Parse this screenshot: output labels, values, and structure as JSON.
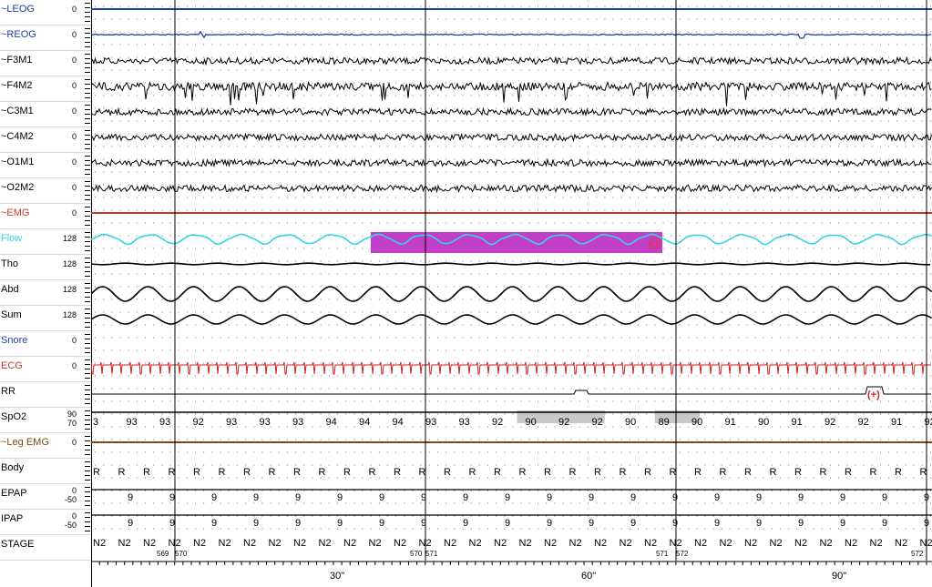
{
  "channels": [
    {
      "id": "leog",
      "label": "~LEOG",
      "gain": "0",
      "label_color": "#1f3fa0",
      "trace_color": "#1f3fa0",
      "kind": "flat-blue"
    },
    {
      "id": "reog",
      "label": "~REOG",
      "gain": "0",
      "label_color": "#1f3fa0",
      "trace_color": "#1f3fa0",
      "kind": "flat-blue-blips"
    },
    {
      "id": "f3m1",
      "label": "~F3M1",
      "gain": "0",
      "label_color": "#000000",
      "trace_color": "#000000",
      "kind": "eeg"
    },
    {
      "id": "f4m2",
      "label": "~F4M2",
      "gain": "0",
      "label_color": "#000000",
      "trace_color": "#000000",
      "kind": "eeg-spiky"
    },
    {
      "id": "c3m1",
      "label": "~C3M1",
      "gain": "0",
      "label_color": "#000000",
      "trace_color": "#000000",
      "kind": "eeg"
    },
    {
      "id": "c4m2",
      "label": "~C4M2",
      "gain": "0",
      "label_color": "#000000",
      "trace_color": "#000000",
      "kind": "eeg"
    },
    {
      "id": "o1m1",
      "label": "~O1M1",
      "gain": "0",
      "label_color": "#000000",
      "trace_color": "#000000",
      "kind": "eeg"
    },
    {
      "id": "o2m2",
      "label": "~O2M2",
      "gain": "0",
      "label_color": "#000000",
      "trace_color": "#000000",
      "kind": "eeg"
    },
    {
      "id": "emg",
      "label": "~EMG",
      "gain": "0",
      "label_color": "#c0392b",
      "trace_color": "#c0392b",
      "kind": "flat-red"
    },
    {
      "id": "flow",
      "label": "Flow",
      "gain": "128",
      "label_color": "#33d4e6",
      "trace_color": "#33d4e6",
      "kind": "flow"
    },
    {
      "id": "tho",
      "label": "Tho",
      "gain": "128",
      "label_color": "#000000",
      "trace_color": "#000000",
      "kind": "tho"
    },
    {
      "id": "abd",
      "label": "Abd",
      "gain": "128",
      "label_color": "#000000",
      "trace_color": "#000000",
      "kind": "resp"
    },
    {
      "id": "sum",
      "label": "Sum",
      "gain": "128",
      "label_color": "#000000",
      "trace_color": "#000000",
      "kind": "resp-small"
    },
    {
      "id": "snore",
      "label": "Snore",
      "gain": "0",
      "label_color": "#1f3fa0",
      "trace_color": "#1f3fa0",
      "kind": "empty"
    },
    {
      "id": "ecg",
      "label": "ECG",
      "gain": "0",
      "label_color": "#c0392b",
      "trace_color": "#d42020",
      "kind": "ecg"
    },
    {
      "id": "rr",
      "label": "RR",
      "gain": "",
      "label_color": "#000000",
      "trace_color": "#000000",
      "kind": "rr"
    },
    {
      "id": "spo2",
      "label": "SpO2",
      "gain": "90\n70",
      "label_color": "#000000",
      "trace_color": "#000000",
      "kind": "spo2"
    },
    {
      "id": "legemg",
      "label": "~Leg EMG",
      "gain": "0",
      "label_color": "#7a4a10",
      "trace_color": "#7a4a10",
      "kind": "flat-brown"
    },
    {
      "id": "body",
      "label": "Body",
      "gain": "",
      "label_color": "#000000",
      "trace_color": "#000000",
      "kind": "body"
    },
    {
      "id": "epap",
      "label": "EPAP",
      "gain": "0\n-50",
      "label_color": "#000000",
      "trace_color": "#000000",
      "kind": "pap"
    },
    {
      "id": "ipap",
      "label": "IPAP",
      "gain": "0\n-50",
      "label_color": "#000000",
      "trace_color": "#000000",
      "kind": "pap"
    },
    {
      "id": "stage",
      "label": "STAGE",
      "gain": "",
      "label_color": "#000000",
      "trace_color": "#000000",
      "kind": "stage"
    }
  ],
  "spo2_values": [
    "3",
    "93",
    "93",
    "92",
    "93",
    "93",
    "93",
    "94",
    "94",
    "94",
    "93",
    "93",
    "92",
    "90",
    "92",
    "92",
    "90",
    "89",
    "90",
    "91",
    "90",
    "91",
    "92",
    "92",
    "91",
    "92"
  ],
  "spo2_highlights": [
    {
      "from_sec": 17,
      "to_sec": 20.5,
      "color": "#c8c8c8"
    },
    {
      "from_sec": 22.5,
      "to_sec": 24.3,
      "color": "#c8c8c8"
    }
  ],
  "body_value": "R",
  "pap_value": "9",
  "stage_value": "N2",
  "epoch_numbers": [
    "569",
    "570",
    "570",
    "571",
    "571",
    "572",
    "572"
  ],
  "time_labels": [
    "30\"",
    "60\"",
    "90\""
  ],
  "flow_event": {
    "color": "#c23ec9",
    "marker": "@",
    "marker_color": "#e8303a"
  },
  "rr_event_marker": "(+)",
  "rr_event_color": "#d42020",
  "colors": {
    "grid_dot": "#6f6f6f",
    "epoch_line": "#000000"
  }
}
